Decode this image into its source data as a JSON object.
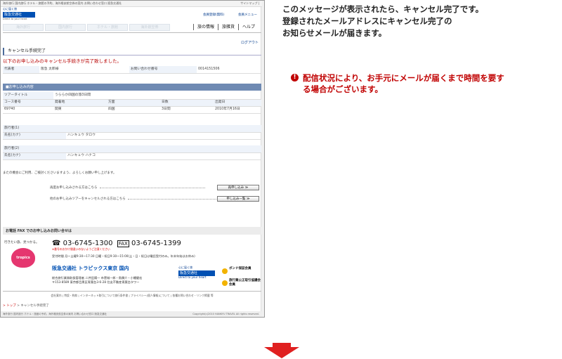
{
  "browser": {
    "top_strip": "海外旅行 国内旅行 ホテル・旅館の予約、海外格安航空券の案内 お問い合わせ窓口 阪急交通社",
    "top_right": "サイトマップ |"
  },
  "logo": {
    "tagline": "心に届く旅",
    "brand": "阪急交通社",
    "sub": "Direct to your heart"
  },
  "header_links": [
    "会員登録(無料)",
    "会員メニュー"
  ],
  "nav_tabs": [
    "海外旅行",
    "国内旅行",
    "ホテル・旅館",
    "海外航空券"
  ],
  "right_nav": [
    "旅の情報",
    "旅雑貨",
    "ヘルプ"
  ],
  "logout": "ログアウト",
  "page_title": "キャンセル手続完了",
  "done_message": "以下のお申し込みのキャンセル手続きが完了致しました。",
  "applicant": [
    "代表者",
    "阪急 太郎様",
    "お問い合わせ番号",
    "0014151506"
  ],
  "section_title": "■お申し込み内容",
  "tour_title_label": "ツアータイトル",
  "tour_title": "うららか四国の旅3日間",
  "course_head": [
    "コース番号",
    "発着地",
    "方面",
    "日数",
    "出発日"
  ],
  "course_vals": [
    "69740",
    "関東",
    "四国",
    "3日間",
    "2010年7月16日"
  ],
  "traveler1": [
    "旅行者(1)",
    "氏名(カナ)",
    "ハンキュウ タロウ"
  ],
  "traveler2": [
    "旅行者(2)",
    "氏名(カナ)",
    "ハンキュウ ハナコ"
  ],
  "closing_note": "またの機会にご利用、ご検討くださいますよう、よろしくお願い申し上げます。",
  "reapply_label": "再度お申し込みされる方はこちら",
  "reapply_button": "再申し込み ≫",
  "other_cancel_label": "他のお申し込みツアーをキャンセルされる方はこちら",
  "other_cancel_button": "申し込み一覧 ≫",
  "contact_bar": "お電話 FAX でのお申し込みお問い合せは",
  "catch": "行きたい旅、見つかる。",
  "heart_logo": "tropics",
  "tel": "03-6745-1300",
  "fax_label": "FAX",
  "fax": "03-6745-1399",
  "phone_note": "※番号のおかけ間違いのないようご注意ください",
  "hours": "受付時間 月～土曜9:30～17:30 日曜・祝日9:30～15:00(土・日・祝日は電話受付のみ。年末年始はお休み)",
  "office_name": "阪急交通社 トラピックス東京 国内",
  "address": [
    "総合旅行業務取扱管理者 二井田陽一 市菅城一郎・角隅介・小幡健宏",
    "〒153-8589 東京都目黒区青葉台3-6-28 住友不動産青葉台タワー"
  ],
  "badge1": "ボンド保証会員",
  "badge2": "旅行業公正取引協議会会員",
  "footer_links": "会社案内 | 特設・約款 | インターネット取引について旅行条件書 | プライバシー(個人情報)について | 各種お問い合わせ・リンク掲載 等",
  "breadcrumb_home": "> トップ",
  "breadcrumb_current": "> キャンセル手続完了",
  "bottom_strip": "海外旅行 国内旅行 ホテル・旅館の予約、海外格安航空券の案内 お問い合わせ窓口 阪急交通社",
  "copyright": "Copyright(c)2010 HANKYU TRAVEL All rights reserved.",
  "explanation": [
    "このメッセージが表示されたら、キャンセル完了です。",
    "登録されたメールアドレスにキャンセル完了の",
    "お知らせメールが届きます。"
  ],
  "warning_icon": "!",
  "warning": [
    "配信状況により、お手元にメールが届くまで時間を要す",
    "る場合がございます。"
  ],
  "accent_color": "#c00000",
  "arrow_icon": "down-arrow"
}
